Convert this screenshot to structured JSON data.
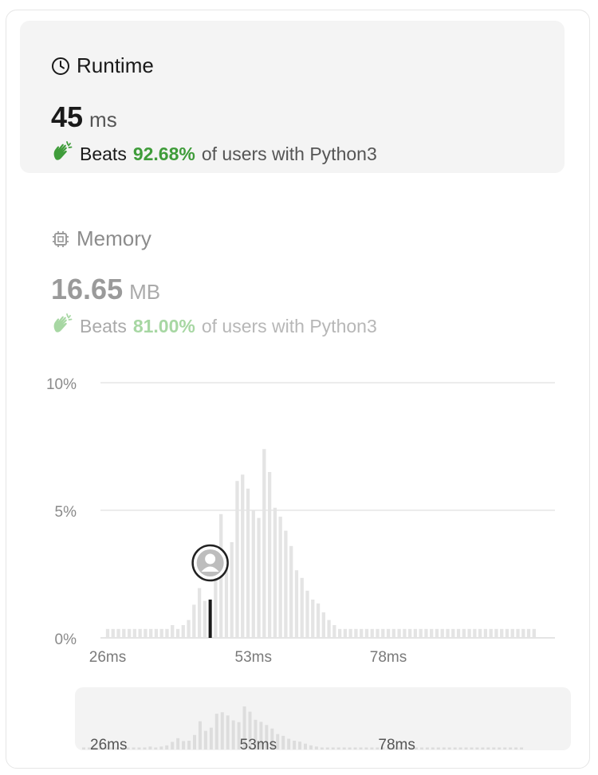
{
  "runtime": {
    "title": "Runtime",
    "value": "45",
    "unit": "ms",
    "beats_label": "Beats",
    "beats_pct": "92.68%",
    "beats_tail": "of users with Python3"
  },
  "memory": {
    "title": "Memory",
    "value": "16.65",
    "unit": "MB",
    "beats_label": "Beats",
    "beats_pct": "81.00%",
    "beats_tail": "of users with Python3"
  },
  "colors": {
    "accent_green": "#3f9c3a",
    "bar": "#e4e4e4",
    "marker": "#1a1a1a"
  },
  "chart_data": {
    "type": "bar",
    "ylim": [
      0,
      10
    ],
    "yticks": [
      {
        "value": 0,
        "label": "0%"
      },
      {
        "value": 5,
        "label": "5%"
      },
      {
        "value": 10,
        "label": "10%"
      }
    ],
    "xticks": [
      {
        "index": 0,
        "label": "26ms"
      },
      {
        "index": 27,
        "label": "53ms"
      },
      {
        "index": 52,
        "label": "78ms"
      }
    ],
    "you_index": 19,
    "you_value": 1.5,
    "values": [
      0.35,
      0.35,
      0.35,
      0.35,
      0.35,
      0.35,
      0.35,
      0.35,
      0.35,
      0.35,
      0.35,
      0.35,
      0.5,
      0.35,
      0.5,
      0.7,
      1.3,
      1.95,
      1.45,
      1.5,
      2.5,
      4.85,
      3.2,
      3.75,
      6.15,
      6.4,
      5.85,
      5.0,
      4.7,
      7.4,
      6.5,
      5.1,
      4.75,
      4.2,
      3.6,
      2.65,
      2.35,
      1.85,
      1.5,
      1.35,
      1.0,
      0.7,
      0.5,
      0.35,
      0.35,
      0.35,
      0.35,
      0.35,
      0.35,
      0.35,
      0.35,
      0.35,
      0.35,
      0.35,
      0.35,
      0.35,
      0.35,
      0.35,
      0.35,
      0.35,
      0.35,
      0.35,
      0.35,
      0.35,
      0.35,
      0.35,
      0.35,
      0.35,
      0.35,
      0.35,
      0.35,
      0.35,
      0.35,
      0.35,
      0.35,
      0.35,
      0.35,
      0.35,
      0.35,
      0.35
    ],
    "overview_xticks": [
      {
        "index": 0,
        "label": "26ms"
      },
      {
        "index": 27,
        "label": "53ms"
      },
      {
        "index": 52,
        "label": "78ms"
      }
    ]
  }
}
